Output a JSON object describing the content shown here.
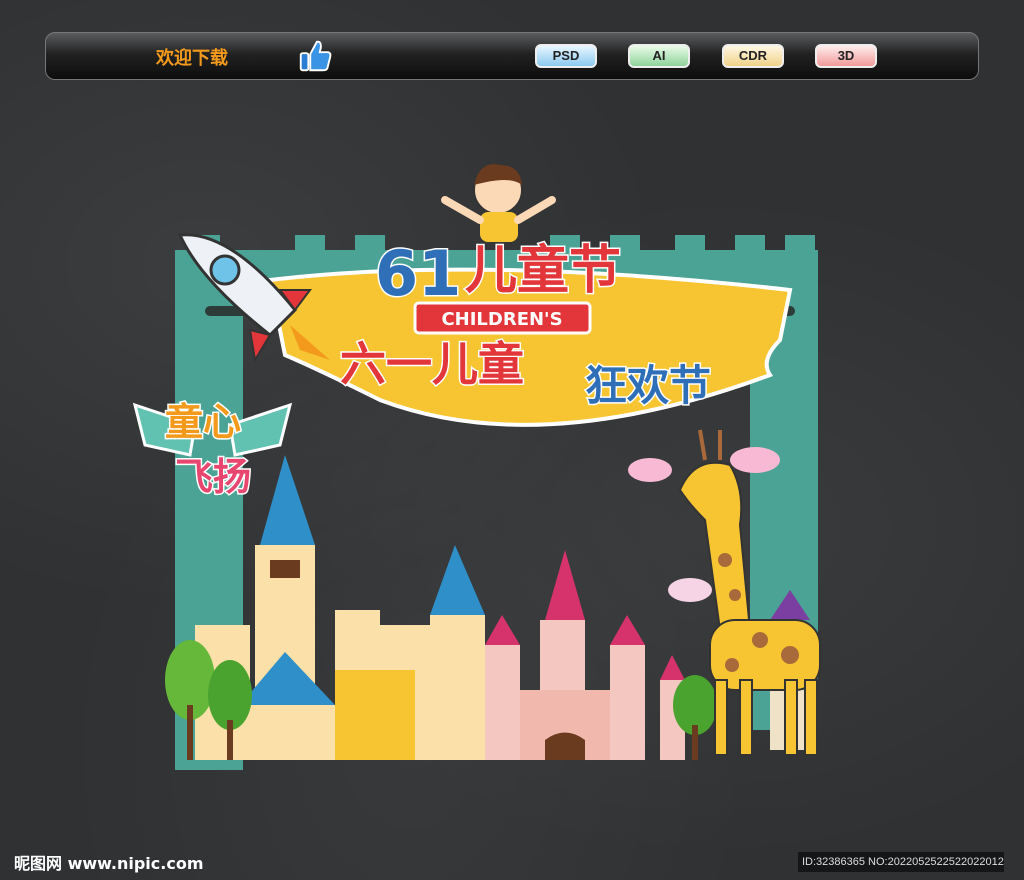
{
  "topbar": {
    "welcome": "欢迎下载",
    "formats": [
      "PSD",
      "AI",
      "CDR",
      "3D"
    ]
  },
  "artwork": {
    "title_number": "61",
    "title_text": "儿童节",
    "subtitle": "CHILDREN'S",
    "banner_text_1": "六一儿童",
    "banner_text_2": "狂欢节",
    "badge_line_1": "童心",
    "badge_line_2": "飞扬"
  },
  "footer": {
    "logo": "昵图网 www.nipic.com",
    "id": "ID:32386365 NO:20220525225220220127"
  },
  "colors": {
    "frame": "#4aa394",
    "banner": "#f6c531",
    "accent_orange": "#f39a1c"
  }
}
